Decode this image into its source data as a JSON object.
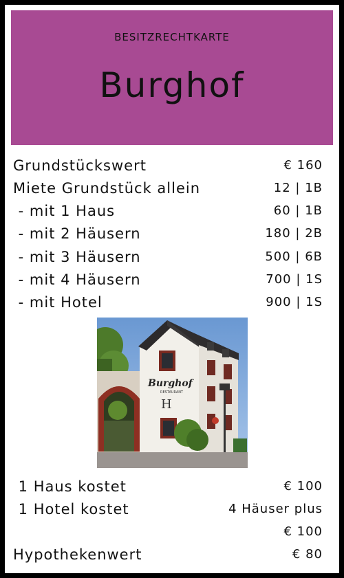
{
  "card": {
    "type_label": "BESITZRECHTKARTE",
    "title": "Burghof",
    "header_color": "#a84a93"
  },
  "rents": [
    {
      "label": "Grundstückswert",
      "value": "€ 160"
    },
    {
      "label": "Miete Grundstück allein",
      "value": "12 | 1B"
    },
    {
      "label": " - mit 1 Haus",
      "value": "60 | 1B"
    },
    {
      "label": " - mit 2 Häusern",
      "value": "180 | 2B"
    },
    {
      "label": " - mit 3 Häusern",
      "value": "500 | 6B"
    },
    {
      "label": " - mit 4 Häusern",
      "value": "700 | 1S"
    },
    {
      "label": " - mit Hotel",
      "value": "900 | 1S"
    }
  ],
  "photo": {
    "sign_text": "Burghof",
    "sign_subtext": "RESTAURANT"
  },
  "costs": {
    "house_label": " 1 Haus kostet",
    "house_value": "€ 100",
    "hotel_label": " 1 Hotel kostet",
    "hotel_value_line1": "4 Häuser plus",
    "hotel_value_line2": "€ 100",
    "mortgage_label": "Hypothekenwert",
    "mortgage_value": "€ 80"
  }
}
